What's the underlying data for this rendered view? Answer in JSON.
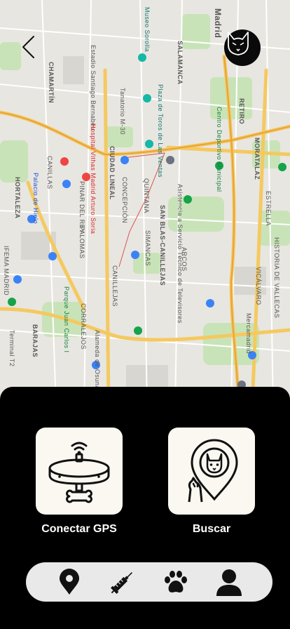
{
  "map": {
    "labels": {
      "chamartin": "CHAMARTÍN",
      "hortaleza": "HORTALEZA",
      "ciudad_lineal": "CIUDAD LINEAL",
      "san_blas": "SAN BLAS-CANILLEJAS",
      "barajas": "BARAJAS",
      "salamanca": "SALAMANCA",
      "retiro": "RETIRO",
      "moratalaz": "MORATALAZ",
      "madrid": "Madrid",
      "estadio": "Estadio Santiago Bernabéu",
      "museo_sorolla": "Museo Sorolla",
      "plaza_toros": "Plaza de Toros de Las Ventas",
      "tanatorio": "Tanatorio M-30",
      "quintana": "QUINTANA",
      "concepcion": "CONCEPCIÓN",
      "simancas": "SIMANCAS",
      "canillejas": "CANILLEJAS",
      "arcos": "ARCOS",
      "hospital": "Hospital Vithas Madrid Arturo Soria",
      "palacio_hielo": "Palacio de Hielo",
      "parque_juan_carlos": "Parque Juan Carlos I",
      "ifema": "IFEMA MADRID",
      "palomas": "PALOMAS",
      "pinar": "PINAR DEL REY",
      "canillas": "CANILLAS",
      "corralejos": "CORRALEJOS",
      "alameda": "Alameda de Osuna",
      "terminal": "Terminal T2",
      "mercamadrid": "Mercamadrid",
      "estrella": "ESTRELLA",
      "vicalvaro": "VICÁLVARO",
      "centro_deportivo": "Centro Deportivo Municipal",
      "aesc": "Asistencia a Servicio Técnico de Televisores",
      "historia": "HISTORIA DE VALLECAS"
    }
  },
  "sheet": {
    "gps_label": "Conectar GPS",
    "search_label": "Buscar"
  },
  "nav": {
    "items": [
      "location-icon",
      "syringe-icon",
      "paw-icon",
      "user-icon"
    ]
  }
}
